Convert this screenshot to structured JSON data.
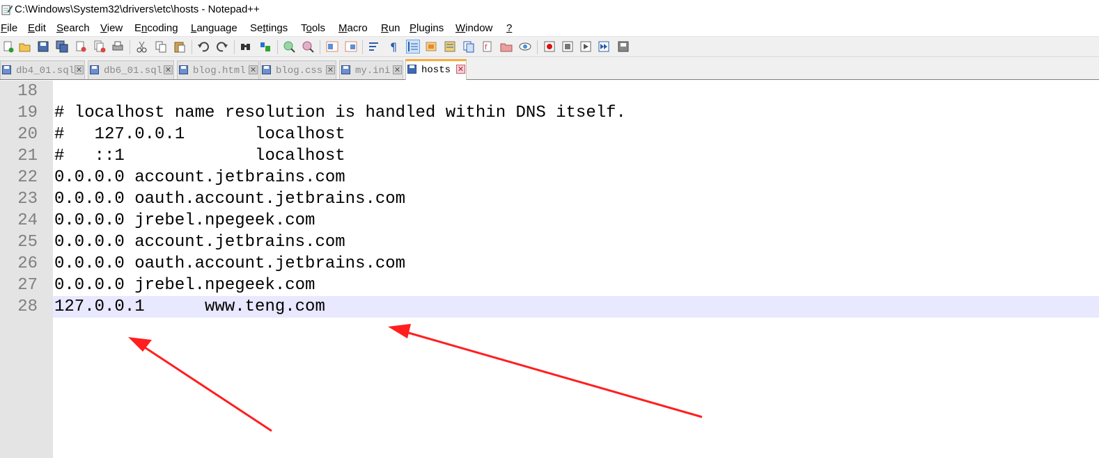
{
  "window": {
    "title": "C:\\Windows\\System32\\drivers\\etc\\hosts - Notepad++"
  },
  "menu": {
    "items": [
      {
        "pre": "",
        "mnemonic": "F",
        "post": "ile"
      },
      {
        "pre": "",
        "mnemonic": "E",
        "post": "dit"
      },
      {
        "pre": "",
        "mnemonic": "S",
        "post": "earch"
      },
      {
        "pre": "",
        "mnemonic": "V",
        "post": "iew"
      },
      {
        "pre": "E",
        "mnemonic": "n",
        "post": "coding"
      },
      {
        "pre": "",
        "mnemonic": "L",
        "post": "anguage"
      },
      {
        "pre": "Se",
        "mnemonic": "t",
        "post": "tings"
      },
      {
        "pre": "T",
        "mnemonic": "o",
        "post": "ols"
      },
      {
        "pre": "",
        "mnemonic": "M",
        "post": "acro"
      },
      {
        "pre": "",
        "mnemonic": "R",
        "post": "un"
      },
      {
        "pre": "",
        "mnemonic": "P",
        "post": "lugins"
      },
      {
        "pre": "",
        "mnemonic": "W",
        "post": "indow"
      },
      {
        "pre": "",
        "mnemonic": "?",
        "post": ""
      }
    ]
  },
  "tabs": [
    {
      "label": "db4_01.sql",
      "active": false
    },
    {
      "label": "db6_01.sql",
      "active": false
    },
    {
      "label": "blog.html",
      "active": false
    },
    {
      "label": "blog.css",
      "active": false
    },
    {
      "label": "my.ini",
      "active": false
    },
    {
      "label": "hosts",
      "active": true
    }
  ],
  "tab_close_glyph": "✕",
  "editor": {
    "current_line": 28,
    "lines": [
      {
        "num": "18",
        "text": ""
      },
      {
        "num": "19",
        "text": "# localhost name resolution is handled within DNS itself."
      },
      {
        "num": "20",
        "text": "#   127.0.0.1       localhost"
      },
      {
        "num": "21",
        "text": "#   ::1             localhost"
      },
      {
        "num": "22",
        "text": "0.0.0.0 account.jetbrains.com"
      },
      {
        "num": "23",
        "text": "0.0.0.0 oauth.account.jetbrains.com"
      },
      {
        "num": "24",
        "text": "0.0.0.0 jrebel.npegeek.com"
      },
      {
        "num": "25",
        "text": "0.0.0.0 account.jetbrains.com"
      },
      {
        "num": "26",
        "text": "0.0.0.0 oauth.account.jetbrains.com"
      },
      {
        "num": "27",
        "text": "0.0.0.0 jrebel.npegeek.com"
      },
      {
        "num": "28",
        "text": "127.0.0.1      www.teng.com"
      }
    ]
  },
  "toolbar": {
    "buttons": [
      "new-file-icon",
      "open-file-icon",
      "save-icon",
      "save-all-icon",
      "close-icon",
      "close-all-icon",
      "print-icon",
      "cut-icon",
      "copy-icon",
      "paste-icon",
      "undo-icon",
      "redo-icon",
      "find-icon",
      "replace-icon",
      "zoom-in-icon",
      "zoom-out-icon",
      "sync-vertical-icon",
      "sync-horizontal-icon",
      "word-wrap-icon",
      "show-all-characters-icon",
      "indent-guide-icon",
      "user-language-icon",
      "doc-map-icon",
      "function-list-icon",
      "folder-as-workspace-icon",
      "document-panel-icon",
      "monitoring-icon",
      "record-macro-icon",
      "stop-recording-icon",
      "playback-macro-icon",
      "run-macro-multiple-icon",
      "save-macro-icon"
    ]
  },
  "colors": {
    "accent_tab": "#faaa3c",
    "current_line_bg": "#e8e8ff",
    "gutter_bg": "#e4e4e4",
    "annotation_arrow": "#ff1f1f"
  }
}
